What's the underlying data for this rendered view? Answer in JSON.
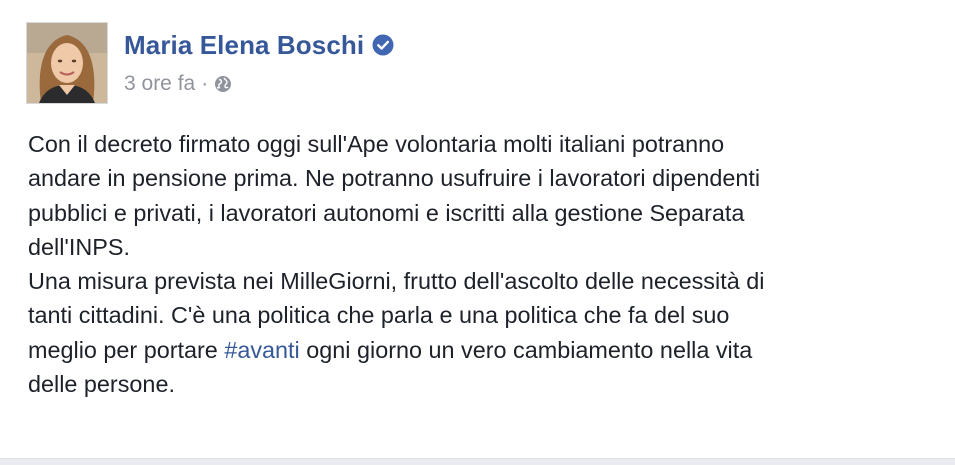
{
  "post": {
    "author": "Maria Elena Boschi",
    "timestamp": "3 ore fa",
    "separator": "·",
    "privacy_icon": "globe-icon",
    "verified_icon": "verified-badge-icon",
    "body": {
      "line1": "Con il decreto firmato oggi sull'Ape volontaria molti italiani potranno",
      "line2": "andare in pensione prima. Ne potranno usufruire i lavoratori dipendenti",
      "line3": "pubblici e privati, i lavoratori autonomi e iscritti alla gestione Separata",
      "line4": "dell'INPS.",
      "line5": "Una misura prevista nei MilleGiorni, frutto dell'ascolto delle necessità di",
      "line6": "tanti cittadini. C'è una politica che parla e una politica che fa del suo",
      "line7_before": "meglio per portare ",
      "line7_hashtag": "#avanti",
      "line7_after": " ogni giorno un vero cambiamento nella vita",
      "line8": "delle persone."
    }
  },
  "colors": {
    "link": "#365899",
    "text": "#1d2129",
    "meta": "#90949c",
    "verified": "#4267b2"
  }
}
